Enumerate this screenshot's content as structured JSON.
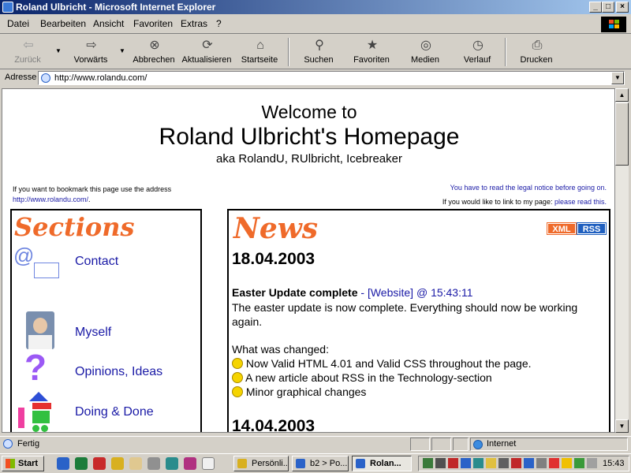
{
  "window": {
    "title": "Roland Ulbricht - Microsoft Internet Explorer",
    "min_glyph": "_",
    "max_glyph": "□",
    "close_glyph": "×"
  },
  "menu": [
    "Datei",
    "Bearbeiten",
    "Ansicht",
    "Favoriten",
    "Extras",
    "?"
  ],
  "toolbar": [
    {
      "label": "Zurück",
      "icon": "back-arrow-icon",
      "glyph": "⇦"
    },
    {
      "label": "Vorwärts",
      "icon": "forward-arrow-icon",
      "glyph": "⇨"
    },
    {
      "label": "Abbrechen",
      "icon": "stop-icon",
      "glyph": "⊗"
    },
    {
      "label": "Aktualisieren",
      "icon": "refresh-icon",
      "glyph": "⟳"
    },
    {
      "label": "Startseite",
      "icon": "home-icon",
      "glyph": "⌂"
    },
    {
      "label": "Suchen",
      "icon": "search-icon",
      "glyph": "⚲"
    },
    {
      "label": "Favoriten",
      "icon": "favorites-icon",
      "glyph": "★"
    },
    {
      "label": "Medien",
      "icon": "media-icon",
      "glyph": "◎"
    },
    {
      "label": "Verlauf",
      "icon": "history-icon",
      "glyph": "◷"
    },
    {
      "label": "Drucken",
      "icon": "print-icon",
      "glyph": "⎙"
    }
  ],
  "address": {
    "label": "Adresse",
    "url": "http://www.rolandu.com/"
  },
  "page": {
    "welcome": "Welcome to",
    "heading": "Roland Ulbricht's Homepage",
    "aka": "aka  RolandU,  RUlbricht,  Icebreaker",
    "bookmark_text": "If you want to bookmark this page use the address",
    "bookmark_link": "http://www.rolandu.com/",
    "bookmark_tail": ".",
    "legal_text": "You have to read the legal notice before going on.",
    "link_text": "If you would like to link to my page: ",
    "link_link": "please read this."
  },
  "sections": {
    "title": "Sections",
    "items": [
      {
        "label": "Contact",
        "icon": "contact-mail-icon"
      },
      {
        "label": "Myself",
        "icon": "portrait-photo-icon"
      },
      {
        "label": "Opinions, Ideas",
        "icon": "question-mark-icon"
      },
      {
        "label": "Doing & Done",
        "icon": "blocks-icon"
      }
    ]
  },
  "news": {
    "title": "News",
    "badges": [
      "XML",
      "RSS"
    ],
    "date1": "18.04.2003",
    "entry_title": "Easter Update complete",
    "entry_sep": " - ",
    "entry_link": "[Website]",
    "entry_at": " @ ",
    "entry_time": "15:43:11",
    "entry_body": "The easter update is now complete. Everything should now be working again.",
    "changed_label": "What was changed:",
    "changes": [
      "Now Valid HTML 4.01 and Valid CSS throughout the page.",
      "A new article about RSS in the Technology-section",
      "Minor graphical changes"
    ],
    "date2": "14.04.2003"
  },
  "status": {
    "text": "Fertig",
    "zone": "Internet"
  },
  "taskbar": {
    "start": "Start",
    "tasks": [
      "Persönli...",
      "b2 > Po...",
      "Rolan..."
    ],
    "clock": "15:43"
  },
  "colors": {
    "accent": "#ef6a2a",
    "link": "#1a1aa6",
    "title_blue": "#0a246a",
    "rss": "#1f5fbf",
    "xml": "#ef6a2a"
  }
}
